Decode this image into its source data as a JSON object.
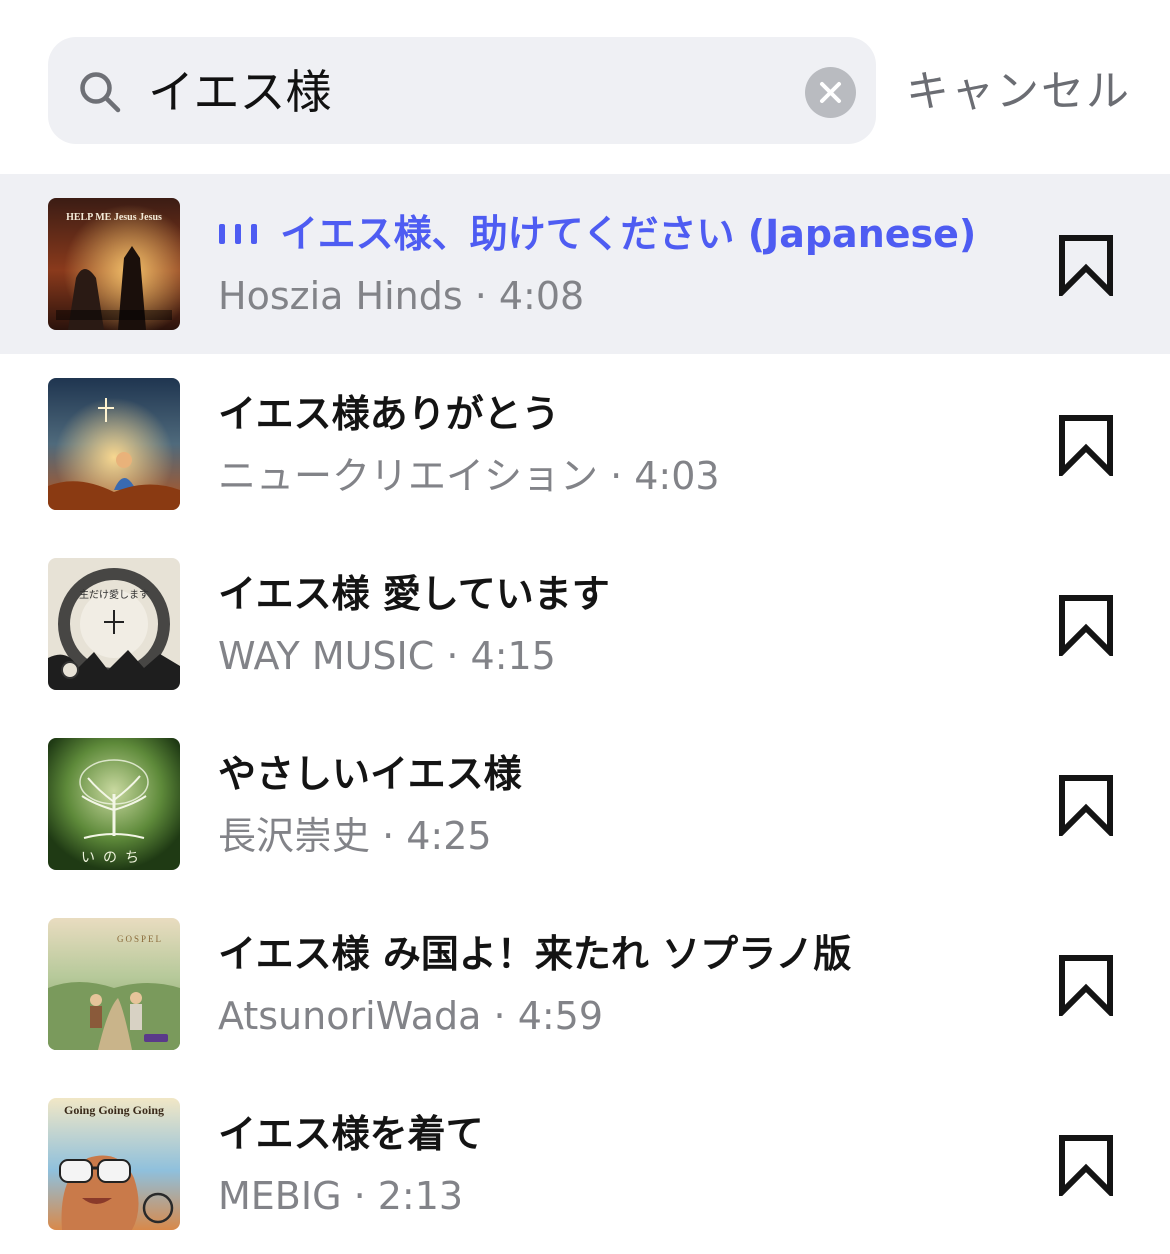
{
  "search": {
    "query": "イエス様",
    "cancel_label": "キャンセル"
  },
  "tracks": [
    {
      "title": "イエス様、助けてください (Japanese)",
      "meta": "Hoszia Hinds · 4:08",
      "playing": true
    },
    {
      "title": "イエス様ありがとう",
      "meta": "ニュークリエイション · 4:03",
      "playing": false
    },
    {
      "title": "イエス様 愛しています",
      "meta": "WAY MUSIC · 4:15",
      "playing": false
    },
    {
      "title": "やさしいイエス様",
      "meta": "長沢崇史 · 4:25",
      "playing": false
    },
    {
      "title": "イエス様 み国よ！来たれ ソプラノ版",
      "meta": "AtsunoriWada · 4:59",
      "playing": false
    },
    {
      "title": "イエス様を着て",
      "meta": "MEBIG · 2:13",
      "playing": false
    }
  ],
  "covers": [
    {
      "text": "HELP ME Jesus Jesus",
      "colors": [
        "#3b1c14",
        "#8a3a1c",
        "#e0a050"
      ]
    },
    {
      "text": "",
      "colors": [
        "#1f3550",
        "#4f6a7c",
        "#d9762a"
      ]
    },
    {
      "text": "主だけ愛します",
      "colors": [
        "#e7e2d6",
        "#2a2a2a",
        "#7a7a7a"
      ]
    },
    {
      "text": "いのち",
      "colors": [
        "#2c4a1e",
        "#5e8a3a",
        "#c9d9a0"
      ]
    },
    {
      "text": "GOSPEL",
      "colors": [
        "#b6c99a",
        "#7a9a5c",
        "#e9dcc0"
      ]
    },
    {
      "text": "Going Going Going",
      "colors": [
        "#e9d6a8",
        "#d8894a",
        "#6aa0c8"
      ]
    }
  ],
  "colors": {
    "accent": "#4e5cf2",
    "playing_row_bg": "#eff0f4",
    "search_bg": "#eff0f4"
  },
  "icons": {
    "search": "magnifier-icon",
    "clear": "clear-x-icon",
    "bookmark": "bookmark-icon",
    "now_playing": "equalizer-icon"
  }
}
